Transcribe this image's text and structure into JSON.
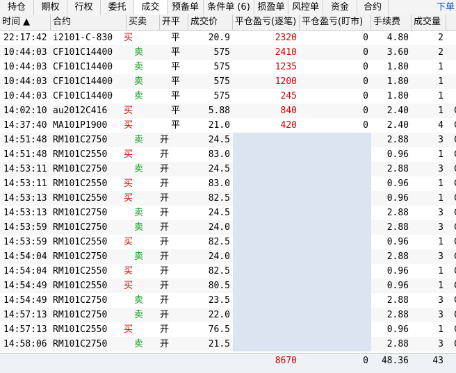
{
  "tabs": [
    {
      "label": "持仓"
    },
    {
      "label": "期权"
    },
    {
      "label": "行权"
    },
    {
      "label": "委托"
    },
    {
      "label": "成交"
    },
    {
      "label": "预备单"
    },
    {
      "label": "条件单 (6)"
    },
    {
      "label": "损盈单"
    },
    {
      "label": "风控单"
    },
    {
      "label": "资金"
    },
    {
      "label": "合约"
    }
  ],
  "active_tab": "成交",
  "right_link": "下单",
  "columns": [
    "时间 ▲",
    "合约",
    "买卖",
    "开平",
    "成交价",
    "平仓盈亏(逐笔)",
    "平仓盈亏(盯市)",
    "手续费",
    "成交量"
  ],
  "rows": [
    {
      "time": "22:17:42",
      "contract": "i2101-C-830",
      "side": "买",
      "oc": "平",
      "price": "20.9",
      "pnl_each": "2320",
      "pnl_mkt": "0",
      "fee": "4.80",
      "vol": "2"
    },
    {
      "time": "10:44:03",
      "contract": "CF101C14400",
      "side": "卖",
      "oc": "平",
      "price": "575",
      "pnl_each": "2410",
      "pnl_mkt": "0",
      "fee": "3.60",
      "vol": "2"
    },
    {
      "time": "10:44:03",
      "contract": "CF101C14400",
      "side": "卖",
      "oc": "平",
      "price": "575",
      "pnl_each": "1235",
      "pnl_mkt": "0",
      "fee": "1.80",
      "vol": "1"
    },
    {
      "time": "10:44:03",
      "contract": "CF101C14400",
      "side": "卖",
      "oc": "平",
      "price": "575",
      "pnl_each": "1200",
      "pnl_mkt": "0",
      "fee": "1.80",
      "vol": "1"
    },
    {
      "time": "10:44:03",
      "contract": "CF101C14400",
      "side": "卖",
      "oc": "平",
      "price": "575",
      "pnl_each": "245",
      "pnl_mkt": "0",
      "fee": "1.80",
      "vol": "1"
    },
    {
      "time": "14:02:10",
      "contract": "au2012C416",
      "side": "买",
      "oc": "平",
      "price": "5.88",
      "pnl_each": "840",
      "pnl_mkt": "0",
      "fee": "2.40",
      "vol": "1",
      "extra": "C"
    },
    {
      "time": "14:37:40",
      "contract": "MA101P1900",
      "side": "买",
      "oc": "平",
      "price": "21.0",
      "pnl_each": "420",
      "pnl_mkt": "0",
      "fee": "2.40",
      "vol": "4",
      "extra": "C"
    },
    {
      "time": "14:51:48",
      "contract": "RM101C2750",
      "side": "卖",
      "oc": "开",
      "price": "24.5",
      "pnl_each": "",
      "pnl_mkt": "",
      "fee": "2.88",
      "vol": "3",
      "extra": "C"
    },
    {
      "time": "14:51:48",
      "contract": "RM101C2550",
      "side": "买",
      "oc": "开",
      "price": "83.0",
      "pnl_each": "",
      "pnl_mkt": "",
      "fee": "0.96",
      "vol": "1",
      "extra": "C"
    },
    {
      "time": "14:53:11",
      "contract": "RM101C2750",
      "side": "卖",
      "oc": "开",
      "price": "24.5",
      "pnl_each": "",
      "pnl_mkt": "",
      "fee": "2.88",
      "vol": "3",
      "extra": "C"
    },
    {
      "time": "14:53:11",
      "contract": "RM101C2550",
      "side": "买",
      "oc": "开",
      "price": "83.0",
      "pnl_each": "",
      "pnl_mkt": "",
      "fee": "0.96",
      "vol": "1",
      "extra": "C"
    },
    {
      "time": "14:53:13",
      "contract": "RM101C2550",
      "side": "买",
      "oc": "开",
      "price": "82.5",
      "pnl_each": "",
      "pnl_mkt": "",
      "fee": "0.96",
      "vol": "1",
      "extra": "C"
    },
    {
      "time": "14:53:13",
      "contract": "RM101C2750",
      "side": "卖",
      "oc": "开",
      "price": "24.5",
      "pnl_each": "",
      "pnl_mkt": "",
      "fee": "2.88",
      "vol": "3",
      "extra": "C"
    },
    {
      "time": "14:53:59",
      "contract": "RM101C2750",
      "side": "卖",
      "oc": "开",
      "price": "24.0",
      "pnl_each": "",
      "pnl_mkt": "",
      "fee": "2.88",
      "vol": "3",
      "extra": "C"
    },
    {
      "time": "14:53:59",
      "contract": "RM101C2550",
      "side": "买",
      "oc": "开",
      "price": "82.5",
      "pnl_each": "",
      "pnl_mkt": "",
      "fee": "0.96",
      "vol": "1",
      "extra": "C"
    },
    {
      "time": "14:54:04",
      "contract": "RM101C2750",
      "side": "卖",
      "oc": "开",
      "price": "24.0",
      "pnl_each": "",
      "pnl_mkt": "",
      "fee": "2.88",
      "vol": "3",
      "extra": "C"
    },
    {
      "time": "14:54:04",
      "contract": "RM101C2550",
      "side": "买",
      "oc": "开",
      "price": "82.5",
      "pnl_each": "",
      "pnl_mkt": "",
      "fee": "0.96",
      "vol": "1",
      "extra": "C"
    },
    {
      "time": "14:54:49",
      "contract": "RM101C2550",
      "side": "买",
      "oc": "开",
      "price": "80.5",
      "pnl_each": "",
      "pnl_mkt": "",
      "fee": "0.96",
      "vol": "1",
      "extra": "C"
    },
    {
      "time": "14:54:49",
      "contract": "RM101C2750",
      "side": "卖",
      "oc": "开",
      "price": "23.5",
      "pnl_each": "",
      "pnl_mkt": "",
      "fee": "2.88",
      "vol": "3",
      "extra": "C"
    },
    {
      "time": "14:57:13",
      "contract": "RM101C2750",
      "side": "卖",
      "oc": "开",
      "price": "22.0",
      "pnl_each": "",
      "pnl_mkt": "",
      "fee": "2.88",
      "vol": "3",
      "extra": "C"
    },
    {
      "time": "14:57:13",
      "contract": "RM101C2550",
      "side": "买",
      "oc": "开",
      "price": "76.5",
      "pnl_each": "",
      "pnl_mkt": "",
      "fee": "0.96",
      "vol": "1",
      "extra": "C"
    },
    {
      "time": "14:58:06",
      "contract": "RM101C2750",
      "side": "卖",
      "oc": "开",
      "price": "21.5",
      "pnl_each": "",
      "pnl_mkt": "",
      "fee": "2.88",
      "vol": "3",
      "extra": "C"
    }
  ],
  "totals": {
    "pnl_each": "8670",
    "pnl_mkt": "0",
    "fee": "48.36",
    "vol": "43"
  },
  "colors": {
    "buy": "#d40000",
    "sell": "#10a020",
    "accent": "#0050d0"
  }
}
